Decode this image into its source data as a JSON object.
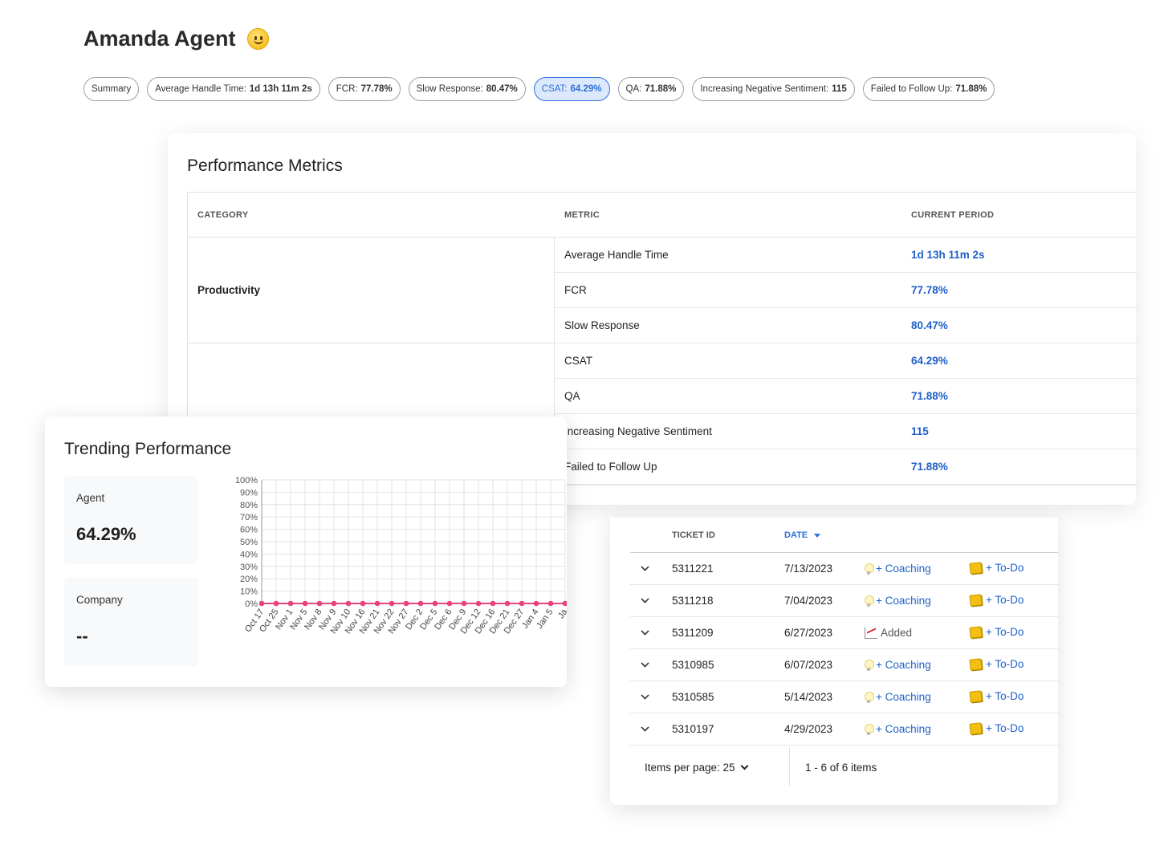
{
  "agent": {
    "name": "Amanda Agent",
    "emoji_icon": "smiley-face-icon"
  },
  "tabs": [
    {
      "label": "Summary",
      "value": ""
    },
    {
      "label": "Average Handle Time:",
      "value": "1d 13h 11m 2s"
    },
    {
      "label": "FCR:",
      "value": "77.78%"
    },
    {
      "label": "Slow Response:",
      "value": "80.47%"
    },
    {
      "label": "CSAT:",
      "value": "64.29%",
      "active": true
    },
    {
      "label": "QA:",
      "value": "71.88%"
    },
    {
      "label": "Increasing Negative Sentiment:",
      "value": "115"
    },
    {
      "label": "Failed to Follow Up:",
      "value": "71.88%"
    }
  ],
  "performance": {
    "title": "Performance Metrics",
    "headers": {
      "category": "CATEGORY",
      "metric": "METRIC",
      "current": "CURRENT PERIOD"
    },
    "categories": [
      "Productivity",
      ""
    ],
    "rows": [
      {
        "metric": "Average Handle Time",
        "value": "1d 13h 11m 2s"
      },
      {
        "metric": "FCR",
        "value": "77.78%"
      },
      {
        "metric": "Slow Response",
        "value": "80.47%"
      },
      {
        "metric": "CSAT",
        "value": "64.29%"
      },
      {
        "metric": "QA",
        "value": "71.88%"
      },
      {
        "metric": "Increasing Negative Sentiment",
        "value": "115"
      },
      {
        "metric": "Failed to Follow Up",
        "value": "71.88%"
      }
    ]
  },
  "trending": {
    "title": "Trending Performance",
    "agent_label": "Agent",
    "agent_value": "64.29%",
    "company_label": "Company",
    "company_value": "--"
  },
  "chart_data": {
    "type": "line",
    "x": [
      "Oct 17",
      "Oct 25",
      "Nov 1",
      "Nov 5",
      "Nov 8",
      "Nov 9",
      "Nov 10",
      "Nov 16",
      "Nov 21",
      "Nov 22",
      "Nov 27",
      "Dec 2",
      "Dec 5",
      "Dec 6",
      "Dec 9",
      "Dec 12",
      "Dec 16",
      "Dec 21",
      "Dec 27",
      "Jan 4",
      "Jan 5",
      "Ja"
    ],
    "series": [
      {
        "values": [
          0,
          0,
          0,
          0,
          0,
          0,
          0,
          0,
          0,
          0,
          0,
          0,
          0,
          0,
          0,
          0,
          0,
          0,
          0,
          0,
          0,
          0
        ],
        "color": "#e8437a"
      }
    ],
    "yticks": [
      "0%",
      "10%",
      "20%",
      "30%",
      "40%",
      "50%",
      "60%",
      "70%",
      "80%",
      "90%",
      "100%"
    ],
    "ylim": [
      0,
      100
    ],
    "grid": true
  },
  "tickets": {
    "headers": {
      "id": "TICKET ID",
      "date": "DATE"
    },
    "rows": [
      {
        "id": "5311221",
        "date": "7/13/2023",
        "coaching": "+ Coaching",
        "coaching_added": false,
        "todo": "+ To-Do"
      },
      {
        "id": "5311218",
        "date": "7/04/2023",
        "coaching": "+ Coaching",
        "coaching_added": false,
        "todo": "+ To-Do"
      },
      {
        "id": "5311209",
        "date": "6/27/2023",
        "coaching": "Added",
        "coaching_added": true,
        "todo": "+ To-Do"
      },
      {
        "id": "5310985",
        "date": "6/07/2023",
        "coaching": "+ Coaching",
        "coaching_added": false,
        "todo": "+ To-Do"
      },
      {
        "id": "5310585",
        "date": "5/14/2023",
        "coaching": "+ Coaching",
        "coaching_added": false,
        "todo": "+ To-Do"
      },
      {
        "id": "5310197",
        "date": "4/29/2023",
        "coaching": "+ Coaching",
        "coaching_added": false,
        "todo": "+ To-Do"
      }
    ],
    "items_per_page": "Items per page: 25",
    "count": "1 - 6 of 6 items"
  },
  "colors": {
    "accent": "#2d6fd6",
    "link": "#2060c8",
    "series": "#e8437a"
  }
}
